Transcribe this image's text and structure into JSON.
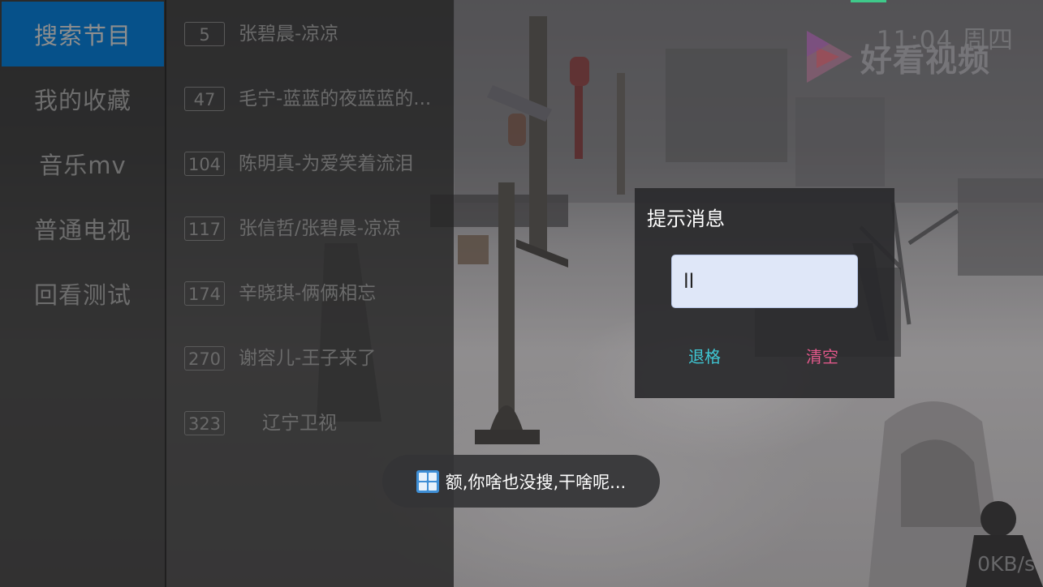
{
  "categories": {
    "items": [
      {
        "label": "搜索节目",
        "active": true
      },
      {
        "label": "我的收藏",
        "active": false
      },
      {
        "label": "音乐mv",
        "active": false
      },
      {
        "label": "普通电视",
        "active": false
      },
      {
        "label": "回看测试",
        "active": false
      }
    ]
  },
  "channels": {
    "items": [
      {
        "number": "5",
        "name": "张碧晨-凉凉"
      },
      {
        "number": "47",
        "name": "毛宁-蓝蓝的夜蓝蓝的..."
      },
      {
        "number": "104",
        "name": "陈明真-为爱笑着流泪"
      },
      {
        "number": "117",
        "name": "张信哲/张碧晨-凉凉"
      },
      {
        "number": "174",
        "name": "辛晓琪-俩俩相忘"
      },
      {
        "number": "270",
        "name": "谢容儿-王子来了"
      },
      {
        "number": "323",
        "name": "辽宁卫视"
      }
    ]
  },
  "overlay": {
    "clock": "11:04 周四",
    "brand": "好看视频",
    "net_speed": "0KB/s",
    "accent_color": "#3fc98a"
  },
  "dialog": {
    "title": "提示消息",
    "input_value": "ll",
    "backspace_label": "退格",
    "clear_label": "清空"
  },
  "toast": {
    "icon": "app-icon",
    "message": "额,你啥也没搜,干啥呢..."
  }
}
